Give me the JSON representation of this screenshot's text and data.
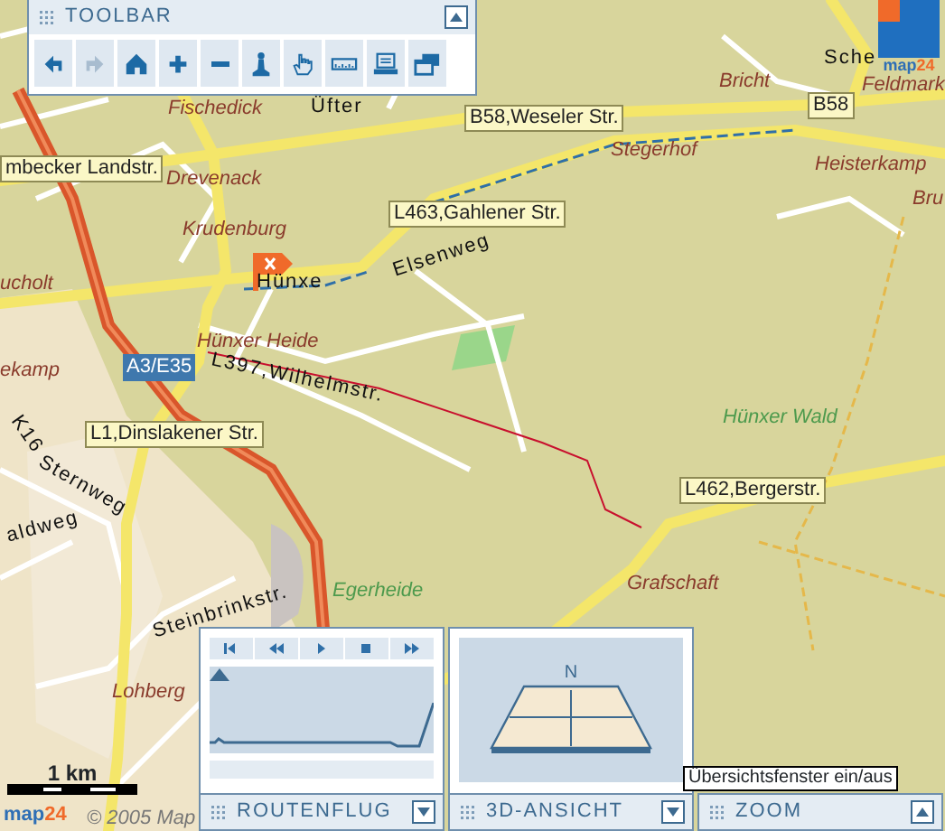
{
  "toolbar": {
    "title": "TOOLBAR",
    "expanded": true,
    "tools": [
      {
        "kind": "back",
        "disabled": false
      },
      {
        "kind": "forward",
        "disabled": true
      },
      {
        "kind": "home",
        "disabled": false
      },
      {
        "kind": "zoom-in",
        "disabled": false
      },
      {
        "kind": "zoom-out",
        "disabled": false
      },
      {
        "kind": "pin",
        "disabled": false
      },
      {
        "kind": "hand",
        "disabled": false
      },
      {
        "kind": "ruler",
        "disabled": false
      },
      {
        "kind": "print",
        "disabled": false
      },
      {
        "kind": "windows",
        "disabled": false
      }
    ]
  },
  "map": {
    "labels": [
      {
        "text": "Sche",
        "kind": "street"
      },
      {
        "text": "Bricht",
        "kind": "place"
      },
      {
        "text": "Feldmark",
        "kind": "place"
      },
      {
        "text": "Fischedick",
        "kind": "place"
      },
      {
        "text": "Üfter",
        "kind": "street"
      },
      {
        "text": "B58,Weseler Str.",
        "kind": "road"
      },
      {
        "text": "B58",
        "kind": "road"
      },
      {
        "text": "mbecker Landstr.",
        "kind": "road"
      },
      {
        "text": "Drevenack",
        "kind": "place"
      },
      {
        "text": "Stegerhof",
        "kind": "place"
      },
      {
        "text": "Heisterkamp",
        "kind": "place"
      },
      {
        "text": "Bru",
        "kind": "place"
      },
      {
        "text": "L463,Gahlener Str.",
        "kind": "road"
      },
      {
        "text": "Krudenburg",
        "kind": "place"
      },
      {
        "text": "Elsenweg",
        "kind": "street"
      },
      {
        "text": "Hünxe",
        "kind": "street"
      },
      {
        "text": "ucholt",
        "kind": "place"
      },
      {
        "text": "Hünxer Heide",
        "kind": "place"
      },
      {
        "text": "A3/E35",
        "kind": "highway"
      },
      {
        "text": "L397,Wilhelmstr.",
        "kind": "street"
      },
      {
        "text": "ekamp",
        "kind": "place"
      },
      {
        "text": "Hünxer Wald",
        "kind": "forest"
      },
      {
        "text": "L1,Dinslakener Str.",
        "kind": "road"
      },
      {
        "text": "K16",
        "kind": "street"
      },
      {
        "text": "Sternweg",
        "kind": "street"
      },
      {
        "text": "L462,Bergerstr.",
        "kind": "road"
      },
      {
        "text": "aldweg",
        "kind": "street"
      },
      {
        "text": "Egerheide",
        "kind": "forest"
      },
      {
        "text": "Grafschaft",
        "kind": "place"
      },
      {
        "text": "Steinbrinkstr.",
        "kind": "street"
      },
      {
        "text": "Lohberg",
        "kind": "place"
      }
    ],
    "scale": "1 km",
    "copyright": "© 2005 Map",
    "logo": [
      "map",
      "24"
    ],
    "corner_logo": [
      "map",
      "24"
    ]
  },
  "panels": [
    {
      "title": "ROUTENFLUG",
      "kind": "routeflight",
      "expanded": true,
      "level": 0
    },
    {
      "title": "3D-ANSICHT",
      "kind": "view3d",
      "expanded": true,
      "compass": "N"
    },
    {
      "title": "ZOOM",
      "kind": "zoom",
      "expanded": false
    }
  ],
  "tooltip": "Übersichtsfenster ein/aus"
}
